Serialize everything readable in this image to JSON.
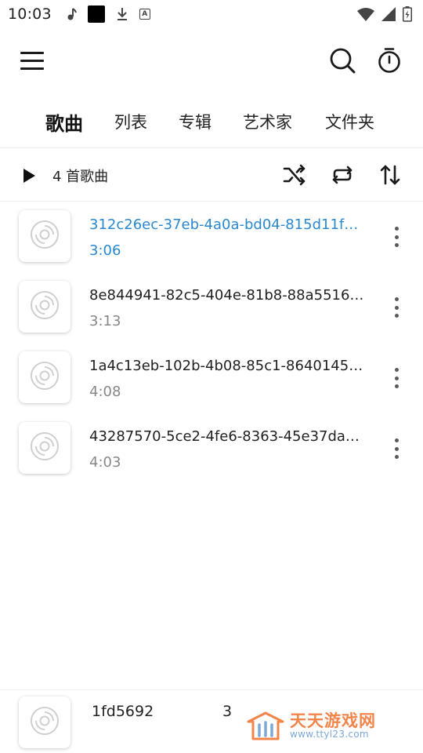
{
  "status_bar": {
    "time": "10:03",
    "left_icons": [
      "music-note-icon",
      "black-square-icon",
      "download-icon",
      "a-box-icon"
    ],
    "right_icons": [
      "wifi-icon",
      "signal-icon",
      "battery-icon"
    ]
  },
  "toolbar": {
    "icons": [
      "menu-icon",
      "search-icon",
      "timer-icon"
    ]
  },
  "tabs": [
    {
      "label": "歌曲",
      "active": true
    },
    {
      "label": "列表",
      "active": false
    },
    {
      "label": "专辑",
      "active": false
    },
    {
      "label": "艺术家",
      "active": false
    },
    {
      "label": "文件夹",
      "active": false
    }
  ],
  "actions": {
    "song_count": "4 首歌曲",
    "icons": [
      "play-icon",
      "shuffle-icon",
      "repeat-icon",
      "sort-icon"
    ]
  },
  "songs": [
    {
      "title": "312c26ec-37eb-4a0a-bd04-815d11f…",
      "duration": "3:06",
      "playing": true
    },
    {
      "title": "8e844941-82c5-404e-81b8-88a5516…",
      "duration": "3:13",
      "playing": false
    },
    {
      "title": "1a4c13eb-102b-4b08-85c1-8640145…",
      "duration": "4:08",
      "playing": false
    },
    {
      "title": "43287570-5ce2-4fe6-8363-45e37da…",
      "duration": "4:03",
      "playing": false
    }
  ],
  "mini_player": {
    "title": "1fd5692",
    "extra": "3"
  },
  "watermark": {
    "name": "天天游戏网",
    "url": "www.ttyl23.com"
  },
  "colors": {
    "accent": "#2a88d0",
    "text": "#1f1f1f",
    "secondary_text": "#888888",
    "watermark_orange": "#f2854a",
    "watermark_blue": "#7aa8d8"
  }
}
